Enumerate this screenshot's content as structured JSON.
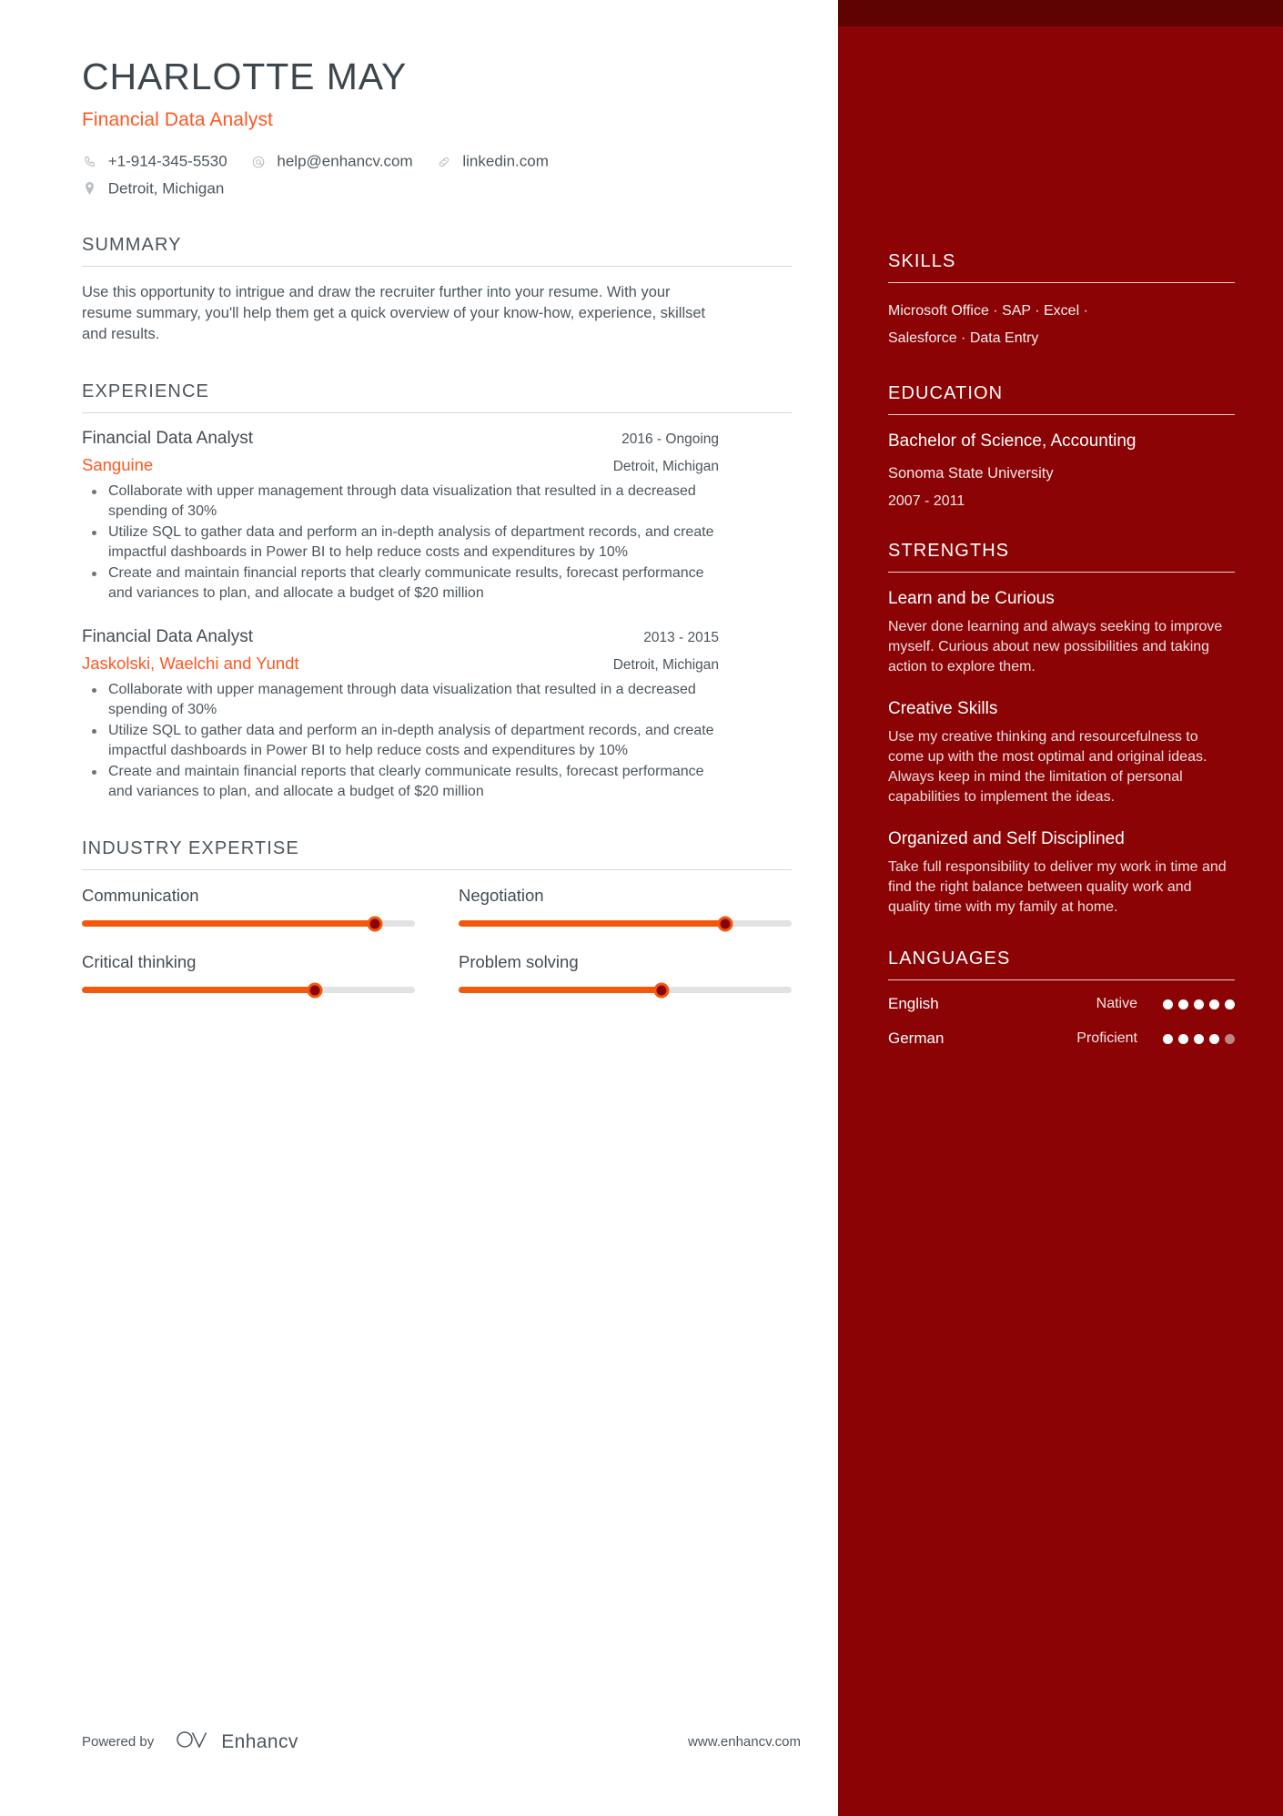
{
  "theme": {
    "accent": "#ff5722",
    "slider_fill": "#f4590b",
    "sidebar_bg": "#8b0304",
    "sidebar_topcap": "#5e0202",
    "text": "#4d565d"
  },
  "header": {
    "name": "CHARLOTTE MAY",
    "job_title": "Financial Data Analyst",
    "contacts": [
      {
        "icon": "phone-icon",
        "text": "+1-914-345-5530"
      },
      {
        "icon": "email-icon",
        "text": "help@enhancv.com"
      },
      {
        "icon": "link-icon",
        "text": "linkedin.com"
      }
    ],
    "location": {
      "icon": "location-icon",
      "text": "Detroit, Michigan"
    }
  },
  "summary": {
    "title": "SUMMARY",
    "text": "Use this opportunity to intrigue and draw the recruiter further into your resume. With your resume summary, you'll help them get a quick overview of your know-how, experience, skillset and results."
  },
  "experience": {
    "title": "EXPERIENCE",
    "entries": [
      {
        "role": "Financial Data Analyst",
        "date": "2016 - Ongoing",
        "company": "Sanguine",
        "location": "Detroit, Michigan",
        "bullets": [
          "Collaborate with upper management through data visualization that resulted in a decreased spending of 30%",
          "Utilize SQL to gather data and perform an in-depth analysis of department records, and create impactful dashboards in Power BI to help reduce costs and expenditures by 10%",
          "Create and maintain financial reports that clearly communicate results, forecast performance and variances to plan, and allocate a budget of $20 million"
        ]
      },
      {
        "role": "Financial Data Analyst",
        "date": "2013 - 2015",
        "company": "Jaskolski, Waelchi and Yundt",
        "location": "Detroit, Michigan",
        "bullets": [
          "Collaborate with upper management through data visualization that resulted in a decreased spending of 30%",
          "Utilize SQL to gather data and perform an in-depth analysis of department records, and create impactful dashboards in Power BI to help reduce costs and expenditures by 10%",
          "Create and maintain financial reports that clearly communicate results, forecast performance and variances to plan, and allocate a budget of $20 million"
        ]
      }
    ]
  },
  "industry_expertise": {
    "title": "INDUSTRY EXPERTISE",
    "items": [
      {
        "label": "Communication",
        "percent": 88
      },
      {
        "label": "Negotiation",
        "percent": 80
      },
      {
        "label": "Critical thinking",
        "percent": 70
      },
      {
        "label": "Problem solving",
        "percent": 61
      }
    ]
  },
  "skills": {
    "title": "SKILLS",
    "lines": [
      "Microsoft Office · SAP · Excel ·",
      "Salesforce · Data Entry"
    ]
  },
  "education": {
    "title": "EDUCATION",
    "degree": "Bachelor of Science, Accounting",
    "school": "Sonoma State University",
    "years": "2007 - 2011"
  },
  "strengths": {
    "title": "STRENGTHS",
    "items": [
      {
        "name": "Learn and be Curious",
        "description": "Never done learning and always seeking to improve myself. Curious about new possibilities and taking action to explore them."
      },
      {
        "name": "Creative Skills",
        "description": "Use my creative thinking and resourcefulness to come up with the most optimal and original ideas. Always keep in mind the limitation of personal capabilities to implement the ideas."
      },
      {
        "name": "Organized and Self Disciplined",
        "description": "Take full responsibility to deliver my work in time and find the right balance between quality work and quality time with my family at home."
      }
    ]
  },
  "languages": {
    "title": "LANGUAGES",
    "items": [
      {
        "name": "English",
        "level": "Native",
        "filled": 5,
        "total": 5
      },
      {
        "name": "German",
        "level": "Proficient",
        "filled": 4,
        "total": 5
      }
    ]
  },
  "footer": {
    "powered_by": "Powered by",
    "brand": "Enhancv",
    "url": "www.enhancv.com"
  }
}
